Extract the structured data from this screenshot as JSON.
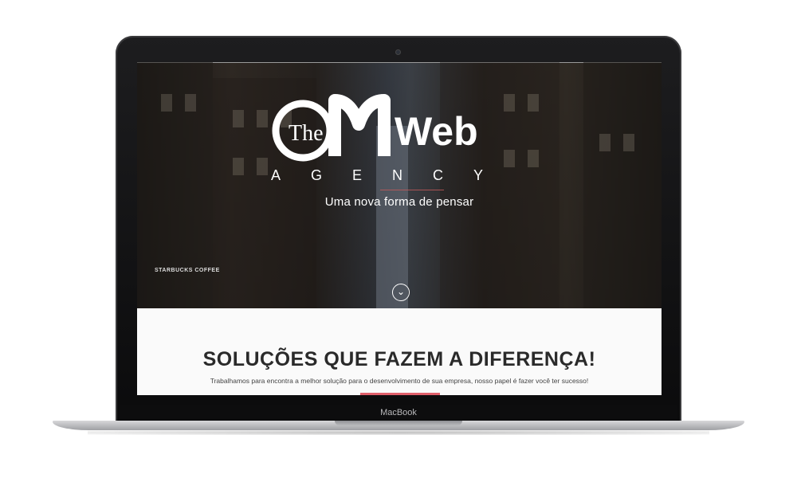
{
  "device": {
    "brand_label": "MacBook"
  },
  "hero": {
    "logo": {
      "the": "The",
      "cm": "CM",
      "web": "Web",
      "agency": "AGENCY"
    },
    "tagline": "Uma nova forma de pensar",
    "scroll_icon": "chevron-down-icon",
    "storefront_sign": "STARBUCKS COFFEE"
  },
  "section": {
    "title": "SOLUÇÕES QUE FAZEM A DIFERENÇA!",
    "description": "Trabalhamos para encontra a melhor solução para o desenvolvimento de sua empresa, nosso papel é fazer você ter sucesso!"
  },
  "colors": {
    "accent": "#e0606b",
    "title_text": "#2a2a2a"
  }
}
